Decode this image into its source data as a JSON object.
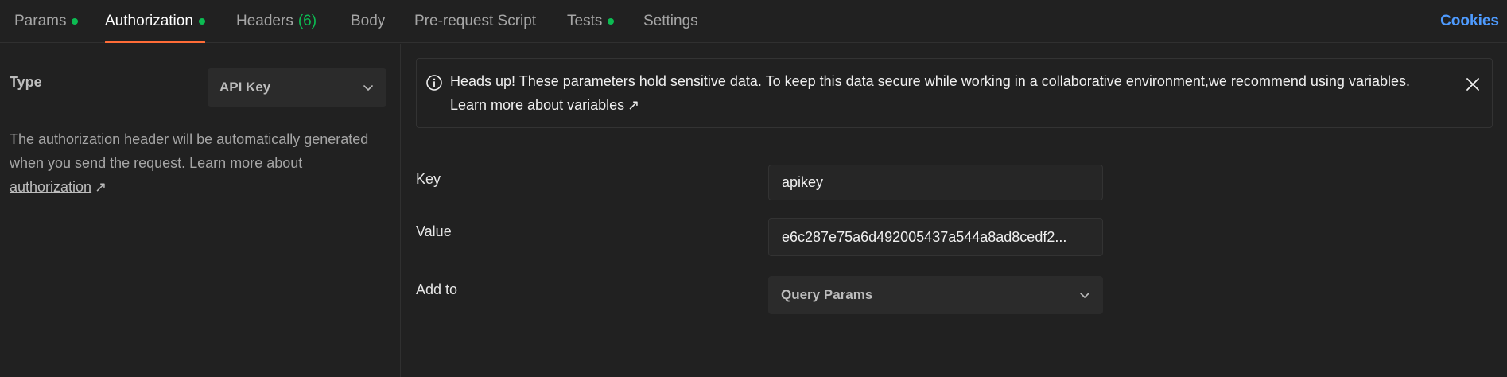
{
  "tabs": [
    {
      "label": "Params",
      "dot": true
    },
    {
      "label": "Authorization",
      "dot": true,
      "active": true
    },
    {
      "label": "Headers",
      "count": "(6)"
    },
    {
      "label": "Body"
    },
    {
      "label": "Pre-request Script"
    },
    {
      "label": "Tests",
      "dot": true
    },
    {
      "label": "Settings"
    }
  ],
  "cookies_label": "Cookies",
  "colors": {
    "accent": "#ff6c37",
    "status_dot": "#0cbb52",
    "link_blue": "#4e9bff",
    "background": "#212121"
  },
  "auth": {
    "type_label": "Type",
    "type_value": "API Key",
    "description": "The authorization header will be automatically generated when you send the request. Learn more about",
    "link_text": "authorization",
    "link_icon": "↗"
  },
  "banner": {
    "icon": "info-icon",
    "text": "Heads up! These parameters hold sensitive data. To keep this data secure while working in a collaborative environment,we recommend using variables. Learn more about",
    "link_text": "variables",
    "link_icon": "↗"
  },
  "fields": {
    "key_label": "Key",
    "key_value": "apikey",
    "value_label": "Value",
    "value_value": "e6c287e75a6d492005437a544a8ad8cedf2...",
    "addto_label": "Add to",
    "addto_value": "Query Params"
  }
}
